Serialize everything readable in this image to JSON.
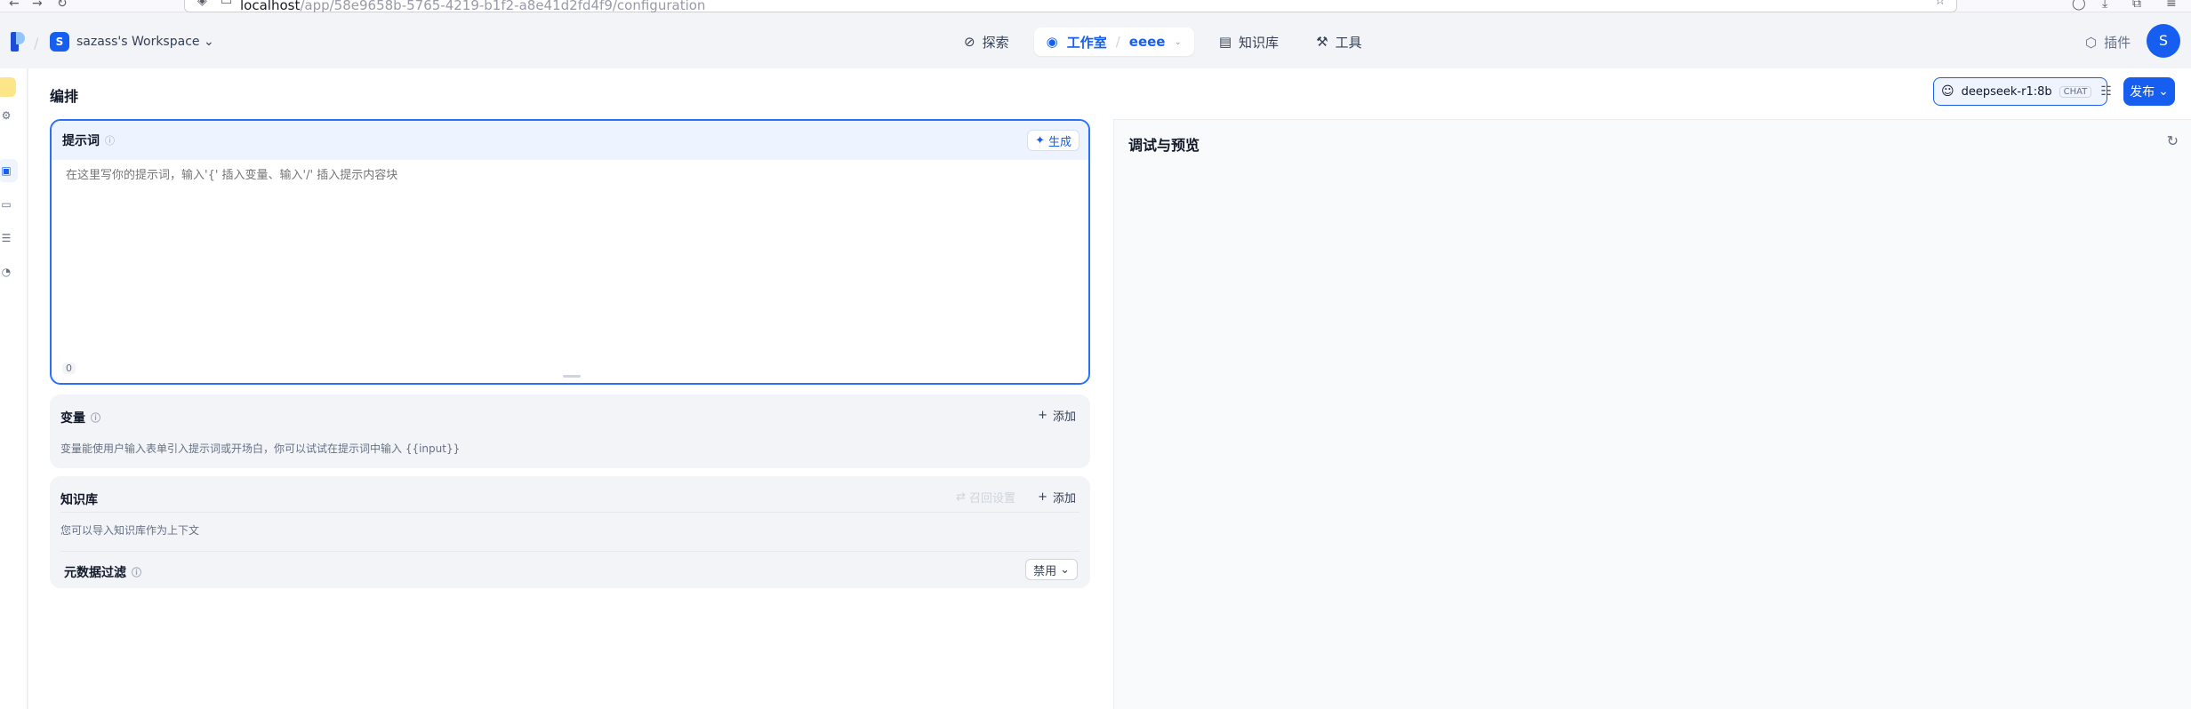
{
  "browser": {
    "url_host": "localhost",
    "url_path": "/app/58e9658b-5765-4219-b1f2-a8e41d2fd4f9/configuration"
  },
  "workspace": {
    "avatar_letter": "S",
    "name": "sazass's Workspace"
  },
  "nav": {
    "explore": "探索",
    "studio": "工作室",
    "app_name": "eeee",
    "knowledge": "知识库",
    "tools": "工具",
    "plugins": "插件"
  },
  "user": {
    "avatar_letter": "S"
  },
  "page": {
    "title": "编排"
  },
  "model": {
    "name": "deepseek-r1:8b",
    "tag": "CHAT"
  },
  "publish": {
    "label": "发布"
  },
  "prompt": {
    "title": "提示词",
    "generate": "生成",
    "placeholder": "在这里写你的提示词，输入'{' 插入变量、输入'/' 插入提示内容块",
    "char_count": "0"
  },
  "variables": {
    "title": "变量",
    "add": "添加",
    "description": "变量能使用户输入表单引入提示词或开场白，你可以试试在提示词中输入 {{input}}"
  },
  "knowledge": {
    "title": "知识库",
    "recall": "召回设置",
    "add": "添加",
    "description": "您可以导入知识库作为上下文",
    "metadata_title": "元数据过滤",
    "metadata_value": "禁用"
  },
  "debug": {
    "title": "调试与预览"
  },
  "colors": {
    "accent": "#155eef",
    "accent_light": "#eff4ff"
  }
}
